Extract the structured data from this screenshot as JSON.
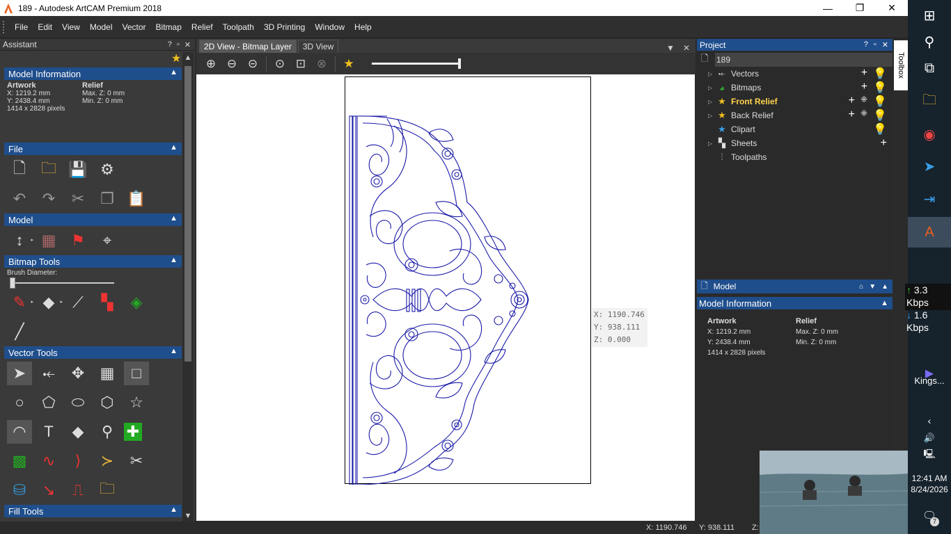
{
  "window": {
    "title": "189 - Autodesk ArtCAM Premium 2018"
  },
  "menu": [
    "File",
    "Edit",
    "View",
    "Model",
    "Vector",
    "Bitmap",
    "Relief",
    "Toolpath",
    "3D Printing",
    "Window",
    "Help"
  ],
  "assistant": {
    "title": "Assistant",
    "model_info": {
      "header": "Model Information",
      "artwork_label": "Artwork",
      "artwork_x": "X: 1219.2 mm",
      "artwork_y": "Y: 2438.4 mm",
      "pixels": "1414 x 2828 pixels",
      "relief_label": "Relief",
      "max_z": "Max. Z: 0 mm",
      "min_z": "Min. Z: 0 mm"
    },
    "sections": {
      "file": "File",
      "model": "Model",
      "bitmap_tools": "Bitmap Tools",
      "brush_diameter": "Brush Diameter:",
      "vector_tools": "Vector Tools",
      "fill_tools": "Fill Tools"
    }
  },
  "document": {
    "tabs": [
      "2D View - Bitmap Layer",
      "3D View"
    ],
    "zoom_level": 1.0
  },
  "cursor_tip": {
    "x": "X: 1190.746",
    "y": "Y: 938.111",
    "z": "Z: 0.000"
  },
  "project": {
    "title": "Project",
    "root": "189",
    "items": [
      {
        "label": "Vectors",
        "icon": "vectors-icon"
      },
      {
        "label": "Bitmaps",
        "icon": "bitmaps-icon"
      },
      {
        "label": "Front Relief",
        "icon": "star-icon",
        "bold": true
      },
      {
        "label": "Back Relief",
        "icon": "star-icon"
      },
      {
        "label": "Clipart",
        "icon": "star-icon"
      },
      {
        "label": "Sheets",
        "icon": "sheets-icon"
      },
      {
        "label": "Toolpaths",
        "icon": "drill-icon"
      }
    ]
  },
  "model_panel": {
    "tab": "Model",
    "header": "Model Information",
    "artwork_label": "Artwork",
    "artwork_x": "X: 1219.2 mm",
    "artwork_y": "Y: 2438.4 mm",
    "pixels": "1414 x 2828 pixels",
    "relief_label": "Relief",
    "max_z": "Max. Z: 0 mm",
    "min_z": "Min. Z: 0 mm"
  },
  "toolbox": "Toolbox",
  "status": {
    "x": "X: 1190.746",
    "y": "Y: 938.111",
    "z": "Z:"
  },
  "taskbar": {
    "net_up": "3.3 Kbps",
    "net_down": "1.6 Kbps",
    "pinned_label": "Kings...",
    "time": "12:41 AM",
    "date": "8/24/2026",
    "notif_count": "7"
  },
  "colors": {
    "accent": "#1f4e8c",
    "artwork_line": "#1a1aa8",
    "highlight": "#ffd34d"
  }
}
